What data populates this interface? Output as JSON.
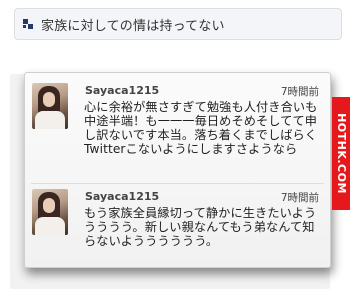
{
  "headline": {
    "text": "家族に対しての情は持ってない"
  },
  "watermark": {
    "text": "HOTHK.COM"
  },
  "tweets": [
    {
      "username": "Sayaca1215",
      "time": "7時間前",
      "text": "心に余裕が無さすぎて勉強も人付き合いも中途半端！も一一一毎日めそめそしてて申し訳ないです本当。落ち着くまでしばらくTwitterこないようにしますさようなら"
    },
    {
      "username": "Sayaca1215",
      "time": "7時間前",
      "text": "もう家族全員縁切って静かに生きたいよううううう。新しい親なんてもう弟なんて知らないようううううう。"
    }
  ],
  "colors": {
    "accent": "#e5191b",
    "headline_mark": "#243a6e"
  },
  "icons": {
    "headline_mark": "headline-mark-icon",
    "avatar": "avatar"
  }
}
